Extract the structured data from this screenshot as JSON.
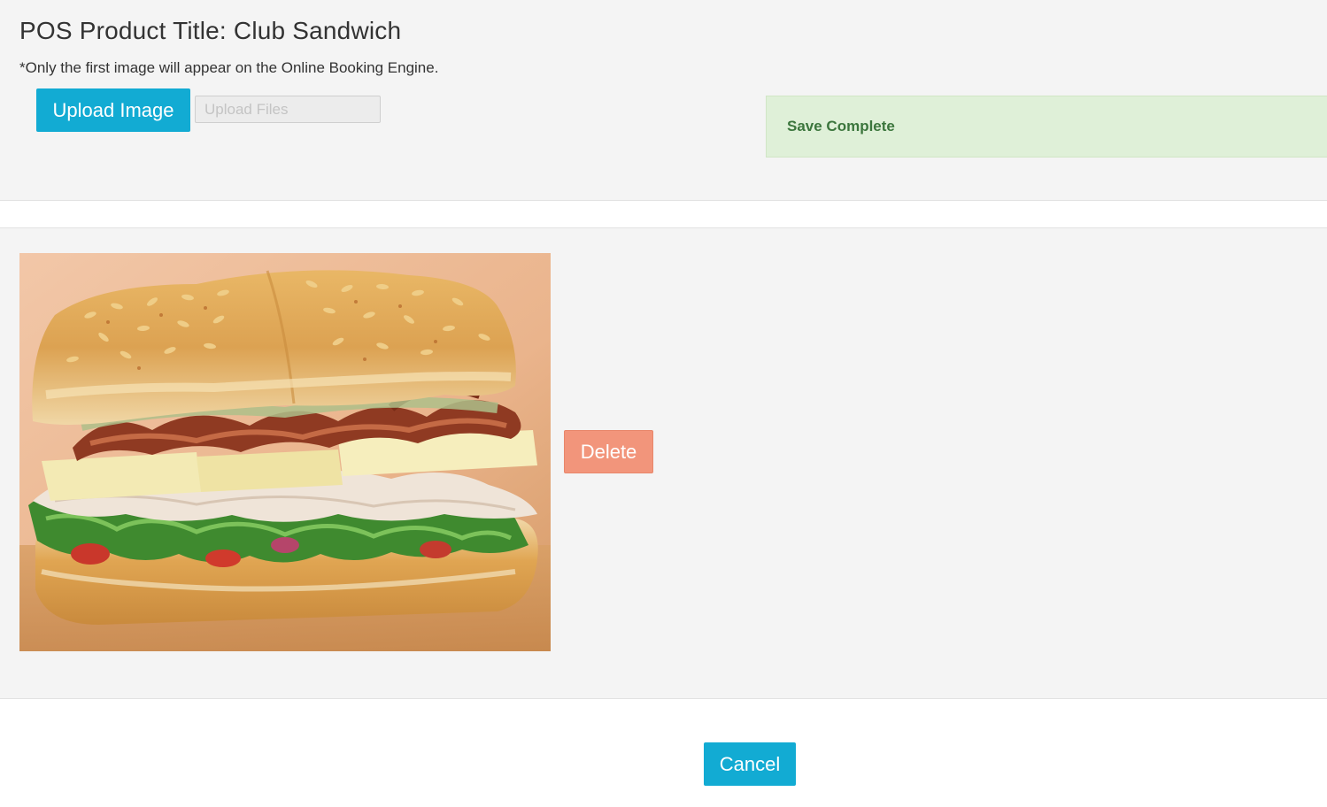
{
  "header": {
    "title": "POS Product Title: Club Sandwich",
    "note": "*Only the first image will appear on the Online Booking Engine."
  },
  "upload": {
    "button_label": "Upload Image",
    "file_placeholder": "Upload Files"
  },
  "alert": {
    "message": "Save Complete"
  },
  "images": {
    "items": [
      {
        "delete_label": "Delete"
      }
    ]
  },
  "footer": {
    "cancel_label": "Cancel"
  },
  "colors": {
    "primary": "#12abd3",
    "danger": "#f2957b",
    "success_bg": "#dff0d8",
    "success_text": "#3c763d",
    "panel_bg": "#f4f4f4"
  }
}
